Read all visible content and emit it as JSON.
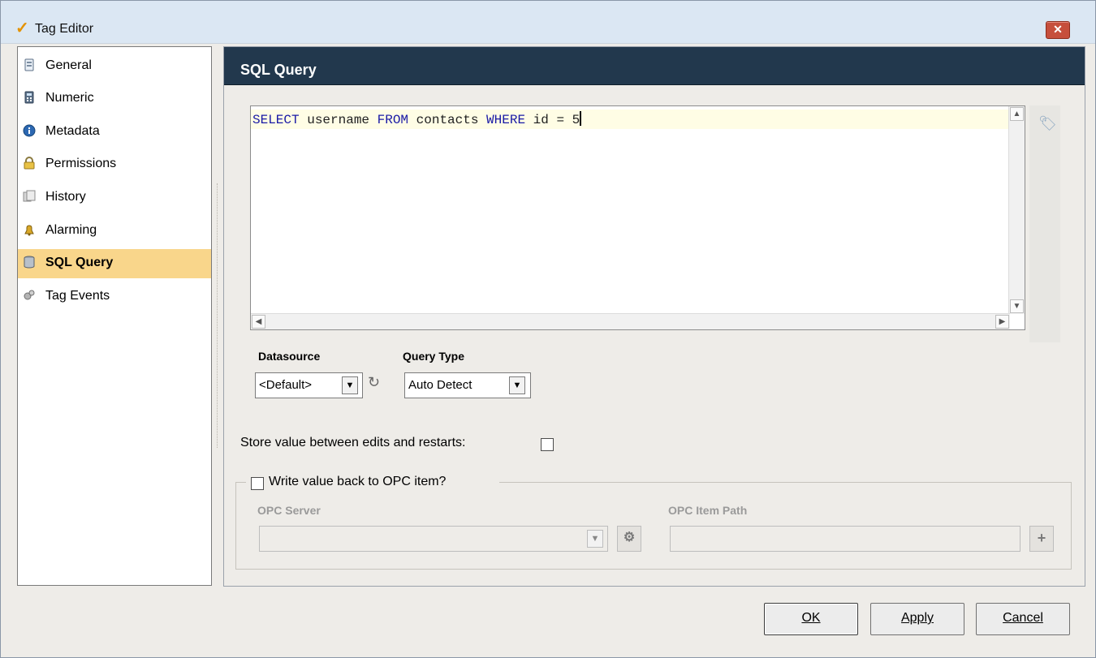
{
  "window": {
    "title": "Tag Editor",
    "close_label": "✕"
  },
  "sidebar": {
    "items": [
      {
        "label": "General",
        "icon": "general-icon",
        "active": false
      },
      {
        "label": "Numeric",
        "icon": "numeric-icon",
        "active": false
      },
      {
        "label": "Metadata",
        "icon": "metadata-icon",
        "active": false
      },
      {
        "label": "Permissions",
        "icon": "lock-icon",
        "active": false
      },
      {
        "label": "History",
        "icon": "history-icon",
        "active": false
      },
      {
        "label": "Alarming",
        "icon": "bell-icon",
        "active": false
      },
      {
        "label": "SQL Query",
        "icon": "database-icon",
        "active": true
      },
      {
        "label": "Tag Events",
        "icon": "gears-icon",
        "active": false
      }
    ]
  },
  "panel": {
    "title": "SQL Query",
    "query": {
      "keyword_select": "SELECT",
      "part_username": " username ",
      "keyword_from": "FROM",
      "part_contacts": " contacts ",
      "keyword_where": "WHERE",
      "part_condition": " id = 5"
    },
    "datasource": {
      "label": "Datasource",
      "value": "<Default>"
    },
    "query_type": {
      "label": "Query Type",
      "value": "Auto Detect"
    },
    "store_value": {
      "label": "Store value between edits and restarts:",
      "checked": false
    },
    "write_back": {
      "label": "Write value back to OPC item?",
      "checked": false,
      "opc_server_label": "OPC Server",
      "opc_server_value": "",
      "opc_item_path_label": "OPC Item Path",
      "opc_item_path_value": ""
    }
  },
  "buttons": {
    "ok": "OK",
    "apply": "Apply",
    "cancel": "Cancel"
  },
  "colors": {
    "accent": "#f9d68b",
    "header": "#22384d",
    "keyword": "#1a1aa6"
  }
}
